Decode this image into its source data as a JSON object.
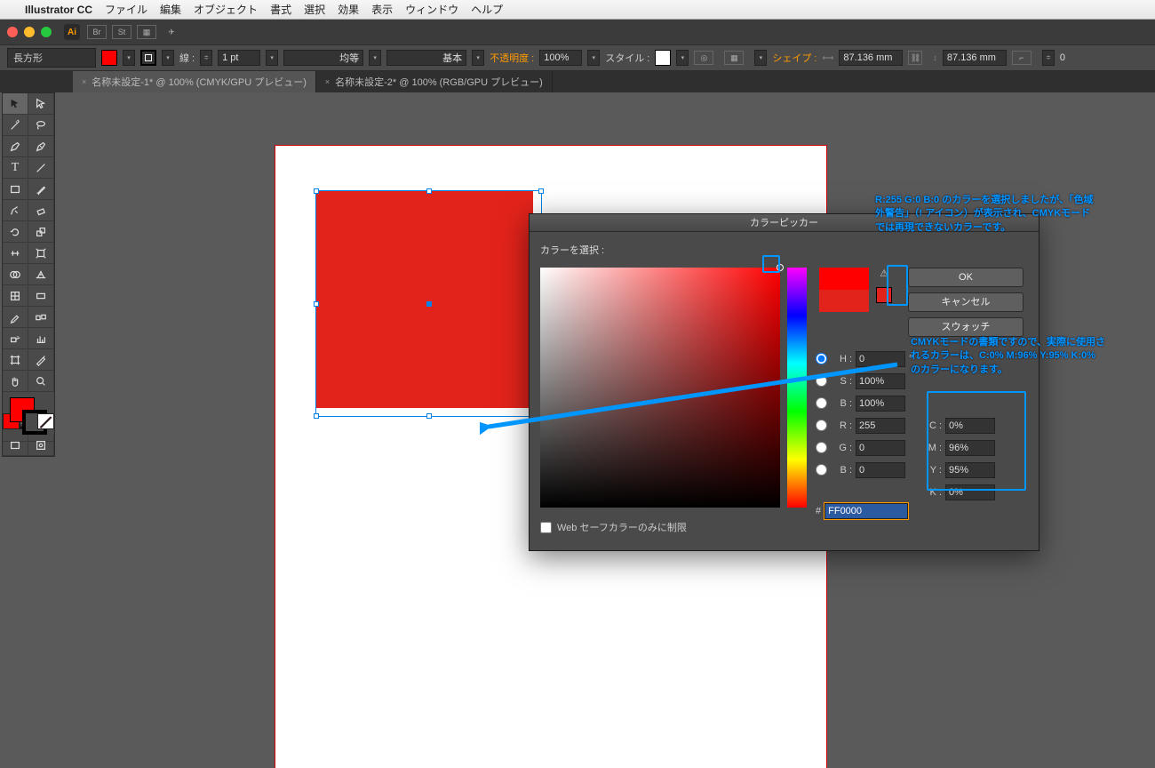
{
  "app": {
    "name": "Illustrator CC"
  },
  "menu": [
    "ファイル",
    "編集",
    "オブジェクト",
    "書式",
    "選択",
    "効果",
    "表示",
    "ウィンドウ",
    "ヘルプ"
  ],
  "control": {
    "tool_label": "長方形",
    "stroke_label": "線 :",
    "stroke_weight": "1 pt",
    "stroke_profile": "均等",
    "brush": "基本",
    "opacity_label": "不透明度 :",
    "opacity": "100%",
    "style_label": "スタイル :",
    "shape_label": "シェイプ :",
    "width": "87.136 mm",
    "height": "87.136 mm"
  },
  "tabs": [
    {
      "label": "名称未設定-1* @ 100% (CMYK/GPU プレビュー)",
      "active": true
    },
    {
      "label": "名称未設定-2* @ 100% (RGB/GPU プレビュー)",
      "active": false
    }
  ],
  "picker": {
    "title": "カラーピッカー",
    "prompt": "カラーを選択 :",
    "ok": "OK",
    "cancel": "キャンセル",
    "swatch": "スウォッチ",
    "hsb": {
      "H": "0",
      "S": "100%",
      "B": "100%"
    },
    "rgb": {
      "R": "255",
      "G": "0",
      "B": "0"
    },
    "hex": "FF0000",
    "cmyk": {
      "C": "0%",
      "M": "96%",
      "Y": "95%",
      "K": "0%"
    },
    "websafe": "Web セーフカラーのみに制限"
  },
  "callouts": {
    "top": "R:255 G:0 B:0 のカラーを選択しましたが、「色域外警告」（! アイコン）が表示され、CMYKモードでは再現できないカラーです。",
    "bottom": "CMYKモードの書類ですので、実際に使用されるカラーは、C:0% M:96% Y:95% K:0% のカラーになります。"
  }
}
